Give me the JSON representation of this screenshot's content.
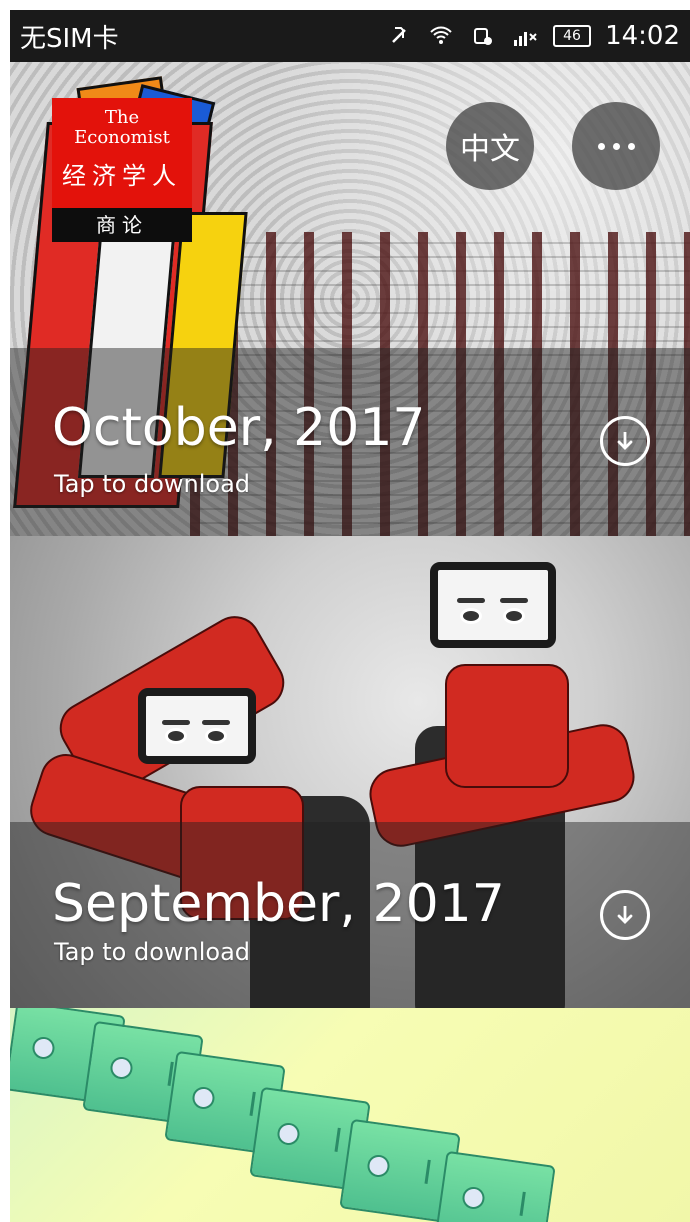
{
  "status_bar": {
    "carrier": "无SIM卡",
    "battery": "46",
    "time": "14:02"
  },
  "issues": [
    {
      "title": "October, 2017",
      "subtitle": "Tap to download",
      "logo": {
        "line1": "The",
        "line2": "Economist",
        "cn": "经济学人",
        "sub": "商论"
      }
    },
    {
      "title": "September, 2017",
      "subtitle": "Tap to download"
    },
    {
      "title": "",
      "subtitle": ""
    }
  ],
  "header_buttons": {
    "language_label": "中文"
  },
  "icons": {
    "status": [
      "mute-icon",
      "wifi-icon",
      "sync-icon",
      "signal-icon",
      "battery-icon"
    ],
    "download": "download-icon",
    "more": "more-icon"
  }
}
